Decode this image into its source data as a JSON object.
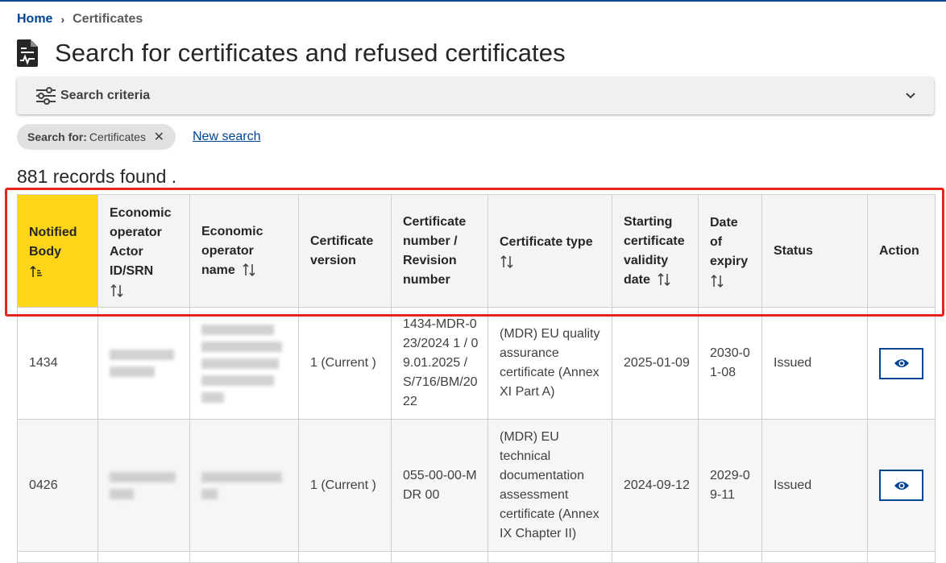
{
  "breadcrumb": {
    "home": "Home",
    "separator": "›",
    "current": "Certificates"
  },
  "page": {
    "title": "Search for certificates and refused certificates",
    "title_icon": "certificate-document-icon"
  },
  "search_criteria": {
    "label": "Search criteria",
    "icon": "sliders-icon",
    "expand_icon": "chevron-down-icon"
  },
  "filter_chip": {
    "prefix": "Search for:",
    "value": "Certificates",
    "remove_symbol": "✕"
  },
  "new_search_label": "New search",
  "records_found": "881 records found .",
  "table": {
    "columns": [
      {
        "label": "Notified Body",
        "sort": "ascending"
      },
      {
        "label": "Economic operator Actor ID/SRN",
        "sort": "sortable"
      },
      {
        "label": "Economic operator name",
        "sort": "sortable"
      },
      {
        "label": "Certificate version",
        "sort": "none"
      },
      {
        "label": "Certificate number / Revision number",
        "sort": "none"
      },
      {
        "label": "Certificate type",
        "sort": "sortable"
      },
      {
        "label": "Starting certificate validity date",
        "sort": "sortable"
      },
      {
        "label": "Date of expiry",
        "sort": "sortable"
      },
      {
        "label": "Status",
        "sort": "none"
      },
      {
        "label": "Action",
        "sort": "none"
      }
    ],
    "rows": [
      {
        "notified_body": "1434",
        "certificate_version": "1 (Current )",
        "certificate_number": "1434-MDR-023/2024 1 / 09.01.2025 / S/716/BM/2022",
        "certificate_type": "(MDR) EU quality assurance certificate (Annex XI Part A)",
        "start_date": "2025-01-09",
        "expiry_date": "2030-01-08",
        "status": "Issued",
        "action_icon": "eye-icon"
      },
      {
        "notified_body": "0426",
        "certificate_version": "1 (Current )",
        "certificate_number": "055-00-00-MDR 00",
        "certificate_type": "(MDR) EU technical documentation assessment certificate (Annex IX Chapter II)",
        "start_date": "2024-09-12",
        "expiry_date": "2029-09-11",
        "status": "Issued",
        "action_icon": "eye-icon"
      }
    ]
  },
  "colors": {
    "primary": "#004494",
    "sorted_header": "#ffd617",
    "highlight": "#e5241e"
  }
}
